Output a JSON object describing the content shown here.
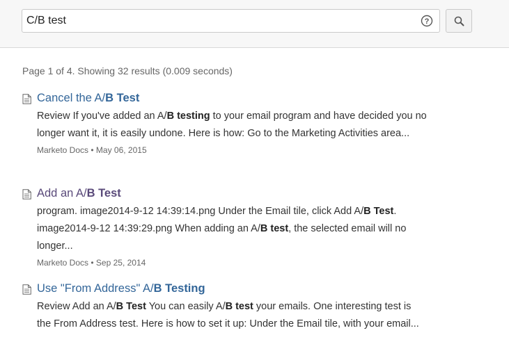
{
  "search": {
    "query": "C/B test",
    "help_symbol": "?"
  },
  "stats": "Page 1 of 4. Showing 32 results (0.009 seconds)",
  "results": [
    {
      "title": [
        {
          "t": "Cancel the A/"
        },
        {
          "t": "B Test",
          "b": true
        }
      ],
      "snippet": [
        {
          "t": "Review If you've added an A/"
        },
        {
          "t": "B testing",
          "b": true
        },
        {
          "t": " to your email program and have decided you no longer want it, it is easily undone. Here is how: Go to the Marketing Activities area..."
        }
      ],
      "source": "Marketo Docs",
      "date": "May 06, 2015",
      "visited": false
    },
    {
      "title": [
        {
          "t": "Add an A/"
        },
        {
          "t": "B Test",
          "b": true
        }
      ],
      "snippet": [
        {
          "t": "program. image2014-9-12 14:39:14.png Under the Email tile, click Add A/"
        },
        {
          "t": "B Test",
          "b": true
        },
        {
          "t": ". image2014-9-12 14:39:29.png When adding an A/"
        },
        {
          "t": "B test",
          "b": true
        },
        {
          "t": ", the selected email will no longer..."
        }
      ],
      "source": "Marketo Docs",
      "date": "Sep 25, 2014",
      "visited": true
    },
    {
      "title": [
        {
          "t": "Use \"From Address\" A/"
        },
        {
          "t": "B Testing",
          "b": true
        }
      ],
      "snippet": [
        {
          "t": "Review Add an A/"
        },
        {
          "t": "B Test",
          "b": true
        },
        {
          "t": " You can easily A/"
        },
        {
          "t": "B test",
          "b": true
        },
        {
          "t": " your emails. One interesting test is the From Address test. Here is how to set it up: Under the Email tile, with your email..."
        }
      ],
      "source": "",
      "date": "",
      "visited": false
    }
  ],
  "colors": {
    "link": "#336699",
    "visited_link": "#5a4a7a",
    "header_bg": "#f7f7f7"
  },
  "icons": {
    "help": "help-circle-icon",
    "search": "magnifier-icon",
    "result": "document-icon"
  }
}
